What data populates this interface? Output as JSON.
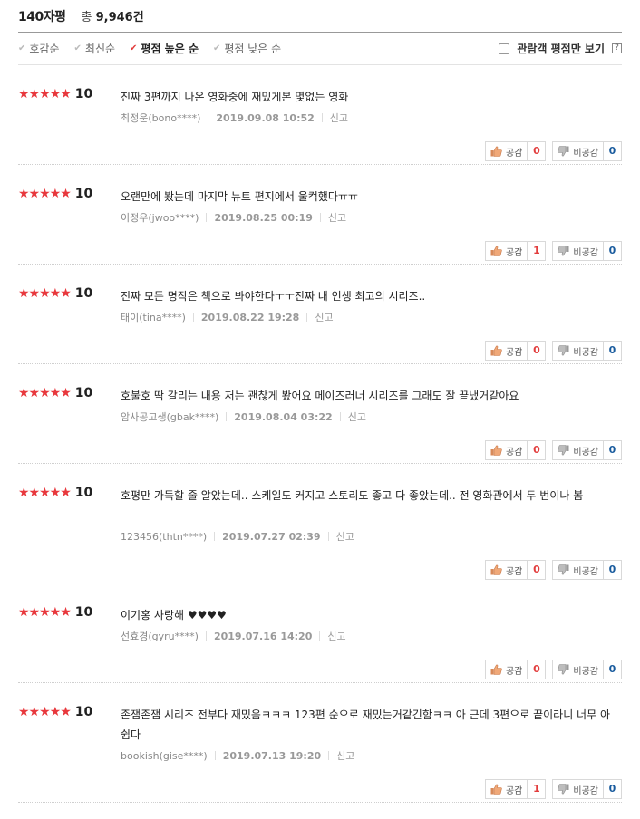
{
  "header": {
    "title": "140자평",
    "total_prefix": "총",
    "total_count": "9,946건"
  },
  "sort": {
    "options": [
      {
        "label": "호감순",
        "active": false
      },
      {
        "label": "최신순",
        "active": false
      },
      {
        "label": "평점 높은 순",
        "active": true
      },
      {
        "label": "평점 낮은 순",
        "active": false
      }
    ],
    "filter_label": "관람객 평점만 보기",
    "help": "?"
  },
  "labels": {
    "like": "공감",
    "dislike": "비공감",
    "report": "신고"
  },
  "reviews": [
    {
      "stars": "★★★★★",
      "score": "10",
      "text": "진짜 3편까지 나온 영화중에 재밌게본 몇없는 영화",
      "author": "최정운(bono****)",
      "date": "2019.09.08 10:52",
      "like": "0",
      "dislike": "0"
    },
    {
      "stars": "★★★★★",
      "score": "10",
      "text": "오랜만에 봤는데 마지막 뉴트 편지에서 울컥했다ㅠㅠ",
      "author": "이정우(jwoo****)",
      "date": "2019.08.25 00:19",
      "like": "1",
      "dislike": "0"
    },
    {
      "stars": "★★★★★",
      "score": "10",
      "text": "진짜 모든 명작은 책으로 봐야한다ㅜㅜ진짜 내 인생 최고의 시리즈..",
      "author": "태이(tina****)",
      "date": "2019.08.22 19:28",
      "like": "0",
      "dislike": "0"
    },
    {
      "stars": "★★★★★",
      "score": "10",
      "text": "호불호 딱 갈리는 내용 저는 괜찮게 봤어요 메이즈러너 시리즈를 그래도 잘 끝냈거같아요",
      "author": "암사공고생(gbak****)",
      "date": "2019.08.04 03:22",
      "like": "0",
      "dislike": "0"
    },
    {
      "stars": "★★★★★",
      "score": "10",
      "text": "호평만 가득할 줄 알았는데.. 스케일도 커지고 스토리도 좋고 다 좋았는데.. 전 영화관에서 두 번이나 봄",
      "author": "123456(thtn****)",
      "date": "2019.07.27 02:39",
      "like": "0",
      "dislike": "0"
    },
    {
      "stars": "★★★★★",
      "score": "10",
      "text": "이기홍 사랑해 ♥♥♥♥",
      "author": "선효경(gyru****)",
      "date": "2019.07.16 14:20",
      "like": "0",
      "dislike": "0"
    },
    {
      "stars": "★★★★★",
      "score": "10",
      "text": "존잼존잼 시리즈 전부다 재밌음ㅋㅋㅋ 123편 순으로 재밌는거같긴함ㅋㅋ 아 근데 3편으로 끝이라니 너무 아쉽다",
      "author": "bookish(gise****)",
      "date": "2019.07.13 19:20",
      "like": "1",
      "dislike": "0"
    }
  ],
  "colors": {
    "star": "#e8383d",
    "like_count": "#e23d3d",
    "dislike_count": "#1a5c9e"
  }
}
